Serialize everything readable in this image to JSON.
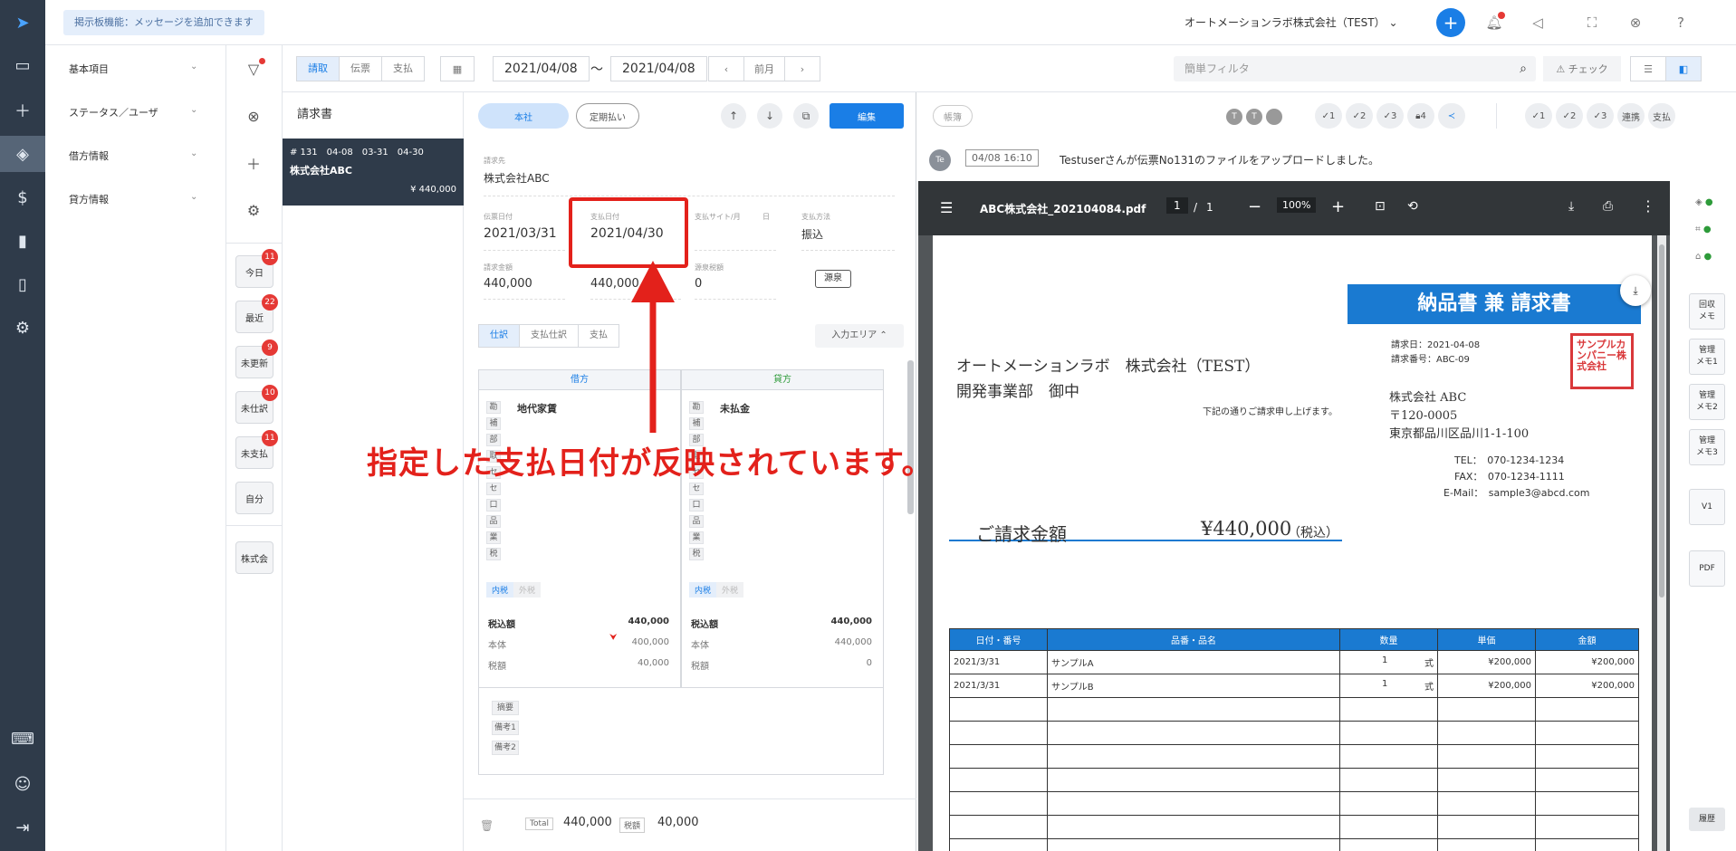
{
  "topbar": {
    "notice": "掲示板機能：メッセージを追加できます",
    "company": "オートメーションラボ株式会社（TEST）"
  },
  "left_panel": {
    "items": [
      "基本項目",
      "ステータス／ユーザ",
      "借方情報",
      "貸方情報"
    ]
  },
  "quick_filters": [
    {
      "label": "今日",
      "count": "11"
    },
    {
      "label": "最近",
      "count": "22"
    },
    {
      "label": "未更新",
      "count": "9"
    },
    {
      "label": "未仕訳",
      "count": "10"
    },
    {
      "label": "未支払",
      "count": "11"
    },
    {
      "label": "自分",
      "count": ""
    }
  ],
  "company_short": "株式会",
  "filterbar": {
    "mode_tabs": [
      "請取",
      "伝票",
      "支払"
    ],
    "date_from": "2021/04/08",
    "tilde": "～",
    "date_to": "2021/04/08",
    "prev_month": "前月",
    "search_placeholder": "簡単フィルタ",
    "check_label": "チェック"
  },
  "list": {
    "header": "請求書",
    "item": {
      "line1": "# 131　04-08　03-31　04-30",
      "company": "株式会社ABC",
      "amount": "¥ 440,000"
    }
  },
  "form": {
    "pill_honsha": "本社",
    "pill_teiki": "定期払い",
    "edit_button": "編集",
    "vendor_label": "請求先",
    "vendor_value": "株式会社ABC",
    "invoice_date_label": "伝票日付",
    "invoice_date": "2021/03/31",
    "payment_date_label": "支払日付",
    "payment_date": "2021/04/30",
    "payment_site_label": "支払サイト/月",
    "payment_site_day": "日",
    "payment_method_label": "支払方法",
    "payment_method": "振込",
    "billed_label": "請求金額",
    "billed_amount": "440,000",
    "paid_amount": "440,000",
    "withholding_label": "源泉税額",
    "withholding_amount": "0",
    "gensen_button": "源泉",
    "tabs": [
      "仕訳",
      "支払仕訳",
      "支払"
    ],
    "input_area": "入力エリア",
    "debit": {
      "header": "借方",
      "account": "地代家賃",
      "chips": [
        "勘",
        "補",
        "部",
        "取",
        "セ",
        "セ",
        "口",
        "品",
        "業",
        "税"
      ],
      "tax_in": "内税",
      "tax_out": "外税",
      "incl_label": "税込額",
      "incl_value": "440,000",
      "body_label": "本体",
      "body_value": "400,000",
      "tax_label": "税額",
      "tax_value": "40,000"
    },
    "credit": {
      "header": "貸方",
      "account": "未払金",
      "chips": [
        "勘",
        "補",
        "部",
        "取",
        "セ",
        "セ",
        "口",
        "品",
        "業",
        "税"
      ],
      "tax_in": "内税",
      "tax_out": "外税",
      "incl_label": "税込額",
      "incl_value": "440,000",
      "body_label": "本体",
      "body_value": "440,000",
      "tax_label": "税額",
      "tax_value": "0"
    },
    "memo_labels": [
      "摘要",
      "備考1",
      "備考2"
    ],
    "footer": {
      "total_label": "Total",
      "total_value": "440,000",
      "tax_label": "税額",
      "tax_value": "40,000"
    }
  },
  "right": {
    "ledger_pill": "帳簿",
    "check_items_a": [
      "1",
      "2",
      "3",
      "4"
    ],
    "check_items_b": [
      "1",
      "2",
      "3"
    ],
    "renkei": "連携",
    "shiharai": "支払",
    "log_avatar": "Te",
    "log_time": "04/08 16:10",
    "log_text": "Testuserさんが伝票No131のファイルをアップロードしました。",
    "pdf": {
      "filename": "ABC株式会社_202104084.pdf",
      "page_current": "1",
      "page_sep": "/",
      "page_total": "1",
      "zoom": "100%"
    },
    "side_buttons": [
      "回収\nメモ",
      "管理\nメモ1",
      "管理\nメモ2",
      "管理\nメモ3",
      "V1",
      "PDF"
    ],
    "history": "履歴"
  },
  "invoice": {
    "title": "納品書 兼 請求書",
    "to_company": "オートメーションラボ　株式会社（TEST）",
    "to_dept": "開発事業部　御中",
    "invoice_date": "請求日：2021-04-08",
    "invoice_no": "請求番号：ABC-09",
    "from_company": "株式会社 ABC",
    "postal": "〒120-0005",
    "address": "東京都品川区品川1-1-100",
    "tel": "TEL：　070-1234-1234",
    "fax": "FAX：　070-1234-1111",
    "email": "E-Mail：　sample3@abcd.com",
    "stamp": "サンプルカンパニー株式会社",
    "greeting": "下記の通りご請求申し上げます。",
    "total_label": "ご請求金額",
    "total_value": "¥440,000",
    "total_note": "（税込）",
    "columns": [
      "日付・番号",
      "品番・品名",
      "数量",
      "単価",
      "金額"
    ],
    "rows": [
      {
        "date": "2021/3/31",
        "name": "サンプルA",
        "qty": "1",
        "unit": "式",
        "price": "¥200,000",
        "amount": "¥200,000"
      },
      {
        "date": "2021/3/31",
        "name": "サンプルB",
        "qty": "1",
        "unit": "式",
        "price": "¥200,000",
        "amount": "¥200,000"
      }
    ]
  },
  "annotation": "指定した支払日付が反映されています。",
  "colors": {
    "accent": "#1a7ee6",
    "rail": "#2f3b4a",
    "annotation": "#e3211b",
    "badge": "#e53935"
  }
}
